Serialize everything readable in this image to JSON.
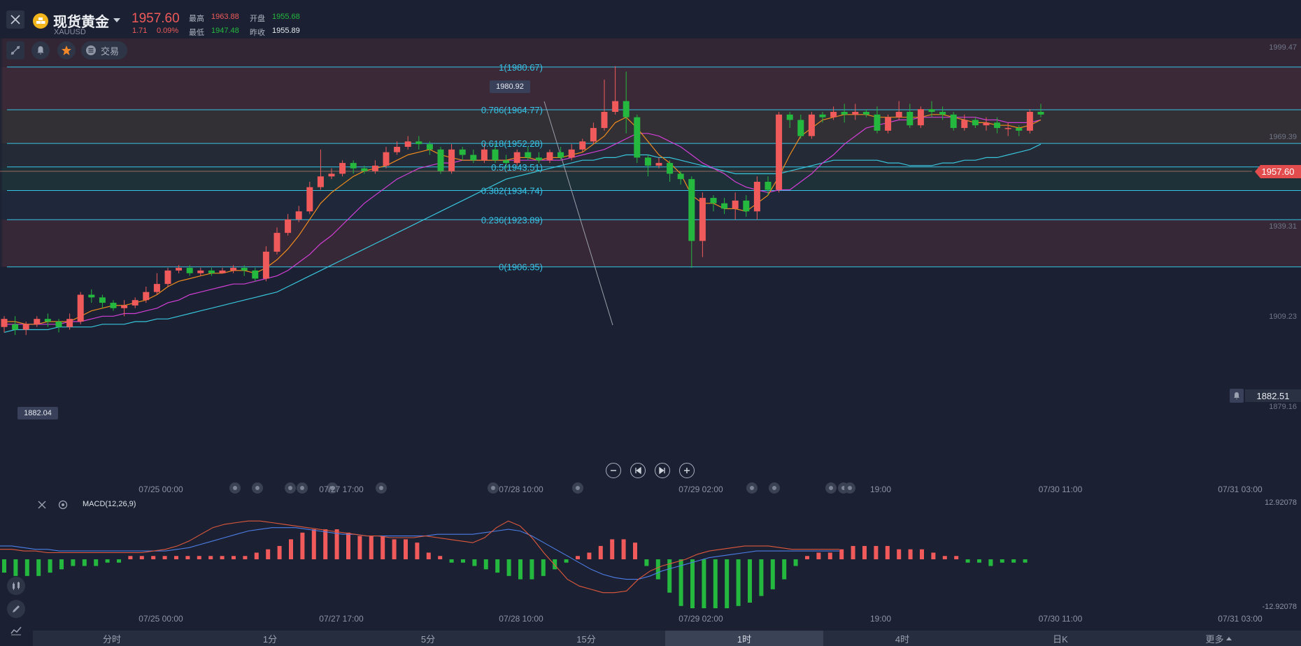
{
  "header": {
    "title": "现货黄金",
    "symbol": "XAUUSD",
    "price": "1957.60",
    "change": "1.71",
    "change_pct": "0.09%",
    "high_label": "最高",
    "high": "1963.88",
    "open_label": "开盘",
    "open": "1955.68",
    "low_label": "最低",
    "low": "1947.48",
    "prev_close_label": "昨收",
    "prev_close": "1955.89",
    "trade_label": "交易"
  },
  "price_axis": [
    "1999.47",
    "1969.39",
    "1939.31",
    "1909.23",
    "1879.16"
  ],
  "current_price_tag": "1957.60",
  "alert_price": "1882.51",
  "markers": {
    "high": "1980.92",
    "low": "1882.04"
  },
  "fib_levels": [
    {
      "label": "1(1980.67)"
    },
    {
      "label": "0.786(1964.77)"
    },
    {
      "label": "0.618(1952.28)"
    },
    {
      "label": "0.5(1943.51)"
    },
    {
      "label": "0.382(1934.74)"
    },
    {
      "label": "0.236(1923.89)"
    },
    {
      "label": "0(1906.35)"
    }
  ],
  "time_axis": [
    "07/25 00:00",
    "07/27 17:00",
    "07/28 10:00",
    "07/29 02:00",
    "19:00",
    "07/30 11:00",
    "07/31 03:00"
  ],
  "macd": {
    "label": "MACD(12,26,9)",
    "max": "12.92078",
    "min": "-12.92078"
  },
  "tabs": [
    "分时",
    "1分",
    "5分",
    "15分",
    "1时",
    "4时",
    "日K",
    "更多"
  ],
  "active_tab": "1时",
  "colors": {
    "up": "#f05a5a",
    "down": "#25b83f",
    "fib": "#37c3e6",
    "ma_short": "#f08c1e",
    "ma_mid": "#d23fd7",
    "ma_long": "#38c5dc"
  },
  "chart_data": {
    "type": "candlestick",
    "ylim": [
      1860,
      2003
    ],
    "candles": [
      [
        1884,
        1887,
        1882,
        1888
      ],
      [
        1885,
        1883,
        1881,
        1888
      ],
      [
        1883,
        1885,
        1881,
        1886
      ],
      [
        1885,
        1887,
        1884,
        1888
      ],
      [
        1887,
        1886,
        1884,
        1889
      ],
      [
        1886,
        1884,
        1882,
        1887
      ],
      [
        1884,
        1887,
        1883,
        1889
      ],
      [
        1886,
        1896,
        1885,
        1897
      ],
      [
        1896,
        1895,
        1893,
        1898
      ],
      [
        1895,
        1893,
        1891,
        1896
      ],
      [
        1893,
        1891,
        1890,
        1894
      ],
      [
        1891,
        1892,
        1888,
        1894
      ],
      [
        1892,
        1894,
        1891,
        1895
      ],
      [
        1894,
        1897,
        1893,
        1899
      ],
      [
        1897,
        1900,
        1896,
        1904
      ],
      [
        1900,
        1905,
        1899,
        1906
      ],
      [
        1905,
        1906,
        1904,
        1907
      ],
      [
        1906,
        1904,
        1903,
        1907
      ],
      [
        1904,
        1905,
        1903,
        1906
      ],
      [
        1905,
        1904,
        1903,
        1906
      ],
      [
        1904,
        1905,
        1904,
        1906
      ],
      [
        1905,
        1906,
        1904,
        1907
      ],
      [
        1906,
        1905,
        1903,
        1907
      ],
      [
        1905,
        1902,
        1901,
        1906
      ],
      [
        1902,
        1912,
        1901,
        1914
      ],
      [
        1912,
        1919,
        1911,
        1921
      ],
      [
        1919,
        1924,
        1918,
        1926
      ],
      [
        1924,
        1927,
        1923,
        1929
      ],
      [
        1927,
        1936,
        1926,
        1938
      ],
      [
        1936,
        1940,
        1935,
        1950
      ],
      [
        1940,
        1941,
        1939,
        1943
      ],
      [
        1941,
        1945,
        1940,
        1946
      ],
      [
        1945,
        1943,
        1941,
        1946
      ],
      [
        1943,
        1942,
        1941,
        1944
      ],
      [
        1942,
        1944,
        1941,
        1946
      ],
      [
        1944,
        1949,
        1943,
        1951
      ],
      [
        1949,
        1951,
        1948,
        1953
      ],
      [
        1951,
        1953,
        1950,
        1955
      ],
      [
        1953,
        1952,
        1950,
        1955
      ],
      [
        1952,
        1950,
        1948,
        1953
      ],
      [
        1950,
        1942,
        1941,
        1951
      ],
      [
        1942,
        1950,
        1941,
        1952
      ],
      [
        1950,
        1948,
        1946,
        1951
      ],
      [
        1948,
        1946,
        1945,
        1950
      ],
      [
        1946,
        1950,
        1945,
        1952
      ],
      [
        1950,
        1946,
        1945,
        1952
      ],
      [
        1946,
        1945,
        1943,
        1948
      ],
      [
        1945,
        1949,
        1944,
        1950
      ],
      [
        1949,
        1947,
        1946,
        1951
      ],
      [
        1947,
        1946,
        1945,
        1949
      ],
      [
        1946,
        1949,
        1945,
        1950
      ],
      [
        1949,
        1947,
        1946,
        1951
      ],
      [
        1947,
        1950,
        1946,
        1952
      ],
      [
        1950,
        1953,
        1949,
        1954
      ],
      [
        1953,
        1958,
        1952,
        1960
      ],
      [
        1958,
        1964,
        1957,
        1976
      ],
      [
        1964,
        1968,
        1963,
        1981
      ],
      [
        1968,
        1962,
        1956,
        1979
      ],
      [
        1962,
        1947,
        1945,
        1963
      ],
      [
        1947,
        1944,
        1940,
        1948
      ],
      [
        1944,
        1945,
        1943,
        1947
      ],
      [
        1945,
        1941,
        1938,
        1946
      ],
      [
        1941,
        1939,
        1937,
        1942
      ],
      [
        1939,
        1916,
        1906,
        1940
      ],
      [
        1916,
        1932,
        1910,
        1934
      ],
      [
        1932,
        1930,
        1927,
        1933
      ],
      [
        1930,
        1928,
        1926,
        1932
      ],
      [
        1928,
        1931,
        1924,
        1934
      ],
      [
        1931,
        1927,
        1925,
        1933
      ],
      [
        1927,
        1938,
        1924,
        1940
      ],
      [
        1938,
        1935,
        1933,
        1940
      ],
      [
        1935,
        1963,
        1934,
        1964
      ],
      [
        1963,
        1961,
        1958,
        1964
      ],
      [
        1961,
        1955,
        1954,
        1963
      ],
      [
        1955,
        1963,
        1954,
        1964
      ],
      [
        1963,
        1962,
        1960,
        1964
      ],
      [
        1962,
        1964,
        1961,
        1966
      ],
      [
        1964,
        1963,
        1960,
        1967
      ],
      [
        1963,
        1964,
        1961,
        1967
      ],
      [
        1964,
        1963,
        1962,
        1965
      ],
      [
        1963,
        1957,
        1956,
        1966
      ],
      [
        1957,
        1962,
        1956,
        1963
      ],
      [
        1962,
        1964,
        1961,
        1968
      ],
      [
        1964,
        1959,
        1958,
        1967
      ],
      [
        1959,
        1965,
        1958,
        1966
      ],
      [
        1965,
        1964,
        1962,
        1968
      ],
      [
        1964,
        1963,
        1961,
        1966
      ],
      [
        1963,
        1958,
        1957,
        1964
      ],
      [
        1958,
        1961,
        1957,
        1963
      ],
      [
        1961,
        1959,
        1958,
        1962
      ],
      [
        1959,
        1960,
        1957,
        1962
      ],
      [
        1960,
        1958,
        1956,
        1962
      ],
      [
        1958,
        1958,
        1955,
        1960
      ],
      [
        1958,
        1957,
        1955,
        1959
      ],
      [
        1957,
        1964,
        1956,
        1965
      ],
      [
        1964,
        1963,
        1962,
        1967
      ]
    ],
    "ma_short": [
      1886,
      1886,
      1885,
      1885,
      1886,
      1886,
      1886,
      1888,
      1890,
      1891,
      1892,
      1892,
      1893,
      1894,
      1896,
      1899,
      1901,
      1902,
      1903,
      1904,
      1904,
      1905,
      1905,
      1904,
      1906,
      1909,
      1913,
      1918,
      1924,
      1930,
      1934,
      1937,
      1940,
      1942,
      1943,
      1944,
      1946,
      1948,
      1949,
      1950,
      1948,
      1947,
      1946,
      1946,
      1946,
      1946,
      1946,
      1947,
      1947,
      1946,
      1947,
      1947,
      1948,
      1949,
      1952,
      1955,
      1960,
      1962,
      1958,
      1953,
      1948,
      1945,
      1941,
      1933,
      1930,
      1930,
      1928,
      1928,
      1927,
      1930,
      1933,
      1940,
      1948,
      1955,
      1958,
      1961,
      1962,
      1963,
      1963,
      1963,
      1962,
      1962,
      1962,
      1962,
      1962,
      1963,
      1963,
      1962,
      1961,
      1960,
      1960,
      1959,
      1959,
      1958,
      1959,
      1961
    ],
    "ma_mid": [
      1885,
      1885,
      1885,
      1885,
      1885,
      1885,
      1886,
      1886,
      1887,
      1888,
      1888,
      1889,
      1889,
      1890,
      1891,
      1893,
      1894,
      1896,
      1897,
      1898,
      1899,
      1900,
      1900,
      1901,
      1902,
      1903,
      1905,
      1908,
      1911,
      1915,
      1918,
      1922,
      1926,
      1930,
      1933,
      1936,
      1939,
      1941,
      1943,
      1944,
      1945,
      1945,
      1946,
      1946,
      1946,
      1946,
      1946,
      1946,
      1946,
      1946,
      1946,
      1946,
      1947,
      1948,
      1949,
      1950,
      1952,
      1954,
      1956,
      1956,
      1955,
      1953,
      1951,
      1948,
      1945,
      1943,
      1941,
      1938,
      1936,
      1935,
      1934,
      1935,
      1935,
      1938,
      1941,
      1945,
      1948,
      1952,
      1955,
      1958,
      1959,
      1960,
      1961,
      1961,
      1962,
      1962,
      1962,
      1962,
      1962,
      1962,
      1961,
      1961,
      1960,
      1960,
      1960,
      1961
    ],
    "ma_long": [
      1882,
      1883,
      1883,
      1883,
      1883,
      1884,
      1884,
      1884,
      1884,
      1885,
      1885,
      1885,
      1886,
      1886,
      1887,
      1887,
      1888,
      1889,
      1890,
      1891,
      1892,
      1893,
      1894,
      1895,
      1896,
      1897,
      1899,
      1901,
      1903,
      1905,
      1907,
      1909,
      1911,
      1913,
      1915,
      1917,
      1919,
      1921,
      1923,
      1925,
      1927,
      1929,
      1931,
      1933,
      1935,
      1937,
      1939,
      1940,
      1941,
      1942,
      1943,
      1944,
      1945,
      1946,
      1946,
      1947,
      1947,
      1948,
      1948,
      1948,
      1947,
      1947,
      1946,
      1945,
      1944,
      1943,
      1942,
      1941,
      1941,
      1941,
      1941,
      1941,
      1942,
      1943,
      1944,
      1945,
      1946,
      1946,
      1946,
      1946,
      1946,
      1945,
      1945,
      1944,
      1944,
      1944,
      1945,
      1945,
      1946,
      1946,
      1947,
      1947,
      1948,
      1949,
      1950,
      1952
    ],
    "macd_hist": [
      -4,
      -5,
      -5,
      -5,
      -4,
      -3,
      -2,
      -2,
      -2,
      -1,
      -1,
      1,
      1,
      1,
      1,
      1,
      1,
      1,
      1,
      1,
      1,
      1,
      2,
      3,
      4,
      6,
      8,
      9,
      9,
      9,
      8,
      7,
      7,
      7,
      6,
      6,
      5,
      2,
      1,
      -1,
      -1,
      -2,
      -3,
      -4,
      -5,
      -6,
      -6,
      -5,
      -3,
      -1,
      1,
      2,
      4,
      6,
      6,
      5,
      -2,
      -6,
      -10,
      -14,
      -16,
      -16,
      -16,
      -15,
      -14,
      -13,
      -11,
      -9,
      -6,
      -2,
      1,
      2,
      2,
      3,
      4,
      4,
      4,
      4,
      3,
      3,
      3,
      2,
      1,
      1,
      -1,
      -1,
      -2,
      -1,
      -1,
      -1
    ],
    "macd_line": [
      3,
      3,
      2.5,
      2.5,
      2,
      2,
      2,
      2,
      2,
      2,
      2,
      2,
      2,
      2.5,
      3,
      4,
      5.5,
      7.5,
      9.5,
      10.5,
      11,
      11.5,
      11.5,
      11,
      10.5,
      10,
      9.5,
      9,
      8.5,
      8,
      7.5,
      7,
      7,
      6.5,
      6.5,
      6.5,
      7,
      6.5,
      6,
      5.5,
      5,
      6.5,
      9.5,
      11.5,
      10,
      6.5,
      2,
      -2,
      -6,
      -8,
      -9,
      -10,
      -10,
      -9.5,
      -6,
      -3.5,
      -2,
      -1,
      0,
      1.5,
      2.5,
      3,
      3.5,
      4,
      4,
      4,
      3.5,
      3,
      3,
      3,
      3,
      3
    ],
    "signal_line": [
      4,
      4,
      3.5,
      3,
      3,
      2.5,
      2.5,
      2.5,
      2.5,
      2.5,
      2.5,
      2.5,
      2.5,
      2.5,
      2.5,
      3,
      3.5,
      4.5,
      5.5,
      6.5,
      7.5,
      8.5,
      9,
      9.5,
      9.5,
      9.5,
      9,
      8.5,
      8,
      7.5,
      7.5,
      7,
      7,
      7,
      7,
      7,
      7,
      7.5,
      7.5,
      7.5,
      7.5,
      8,
      8.5,
      9,
      8.5,
      7,
      5,
      3,
      1,
      -1,
      -3,
      -4.5,
      -5.5,
      -6,
      -6,
      -5,
      -3.5,
      -2.5,
      -1.5,
      -0.5,
      0.5,
      1,
      1.5,
      2,
      2.5,
      2.5,
      2.5,
      2.5,
      2.5,
      2.5,
      2.5,
      2.5
    ]
  }
}
